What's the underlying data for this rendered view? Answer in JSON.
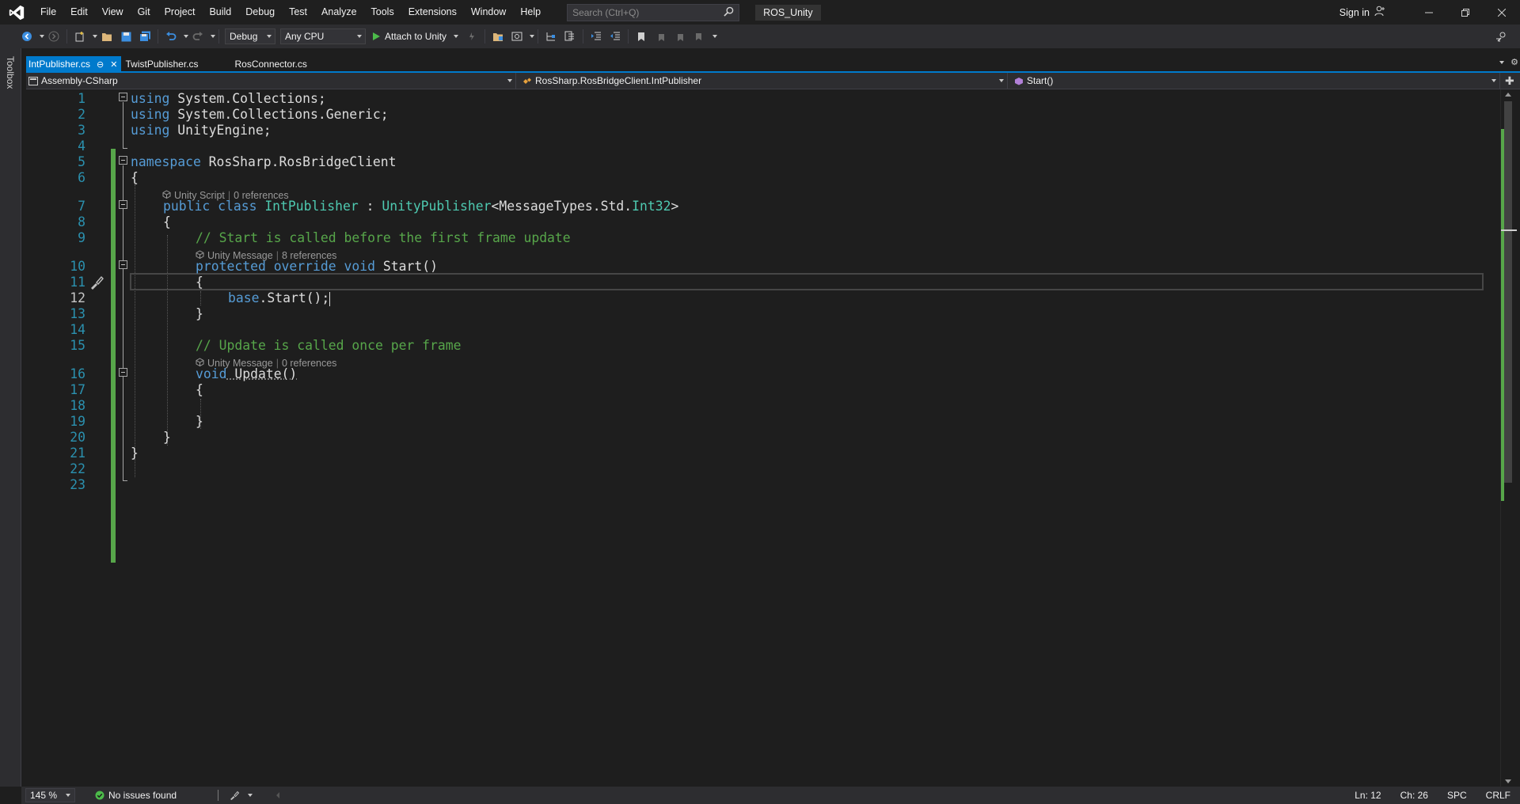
{
  "window": {
    "solution_name": "ROS_Unity",
    "sign_in": "Sign in"
  },
  "menu": {
    "items": [
      "File",
      "Edit",
      "View",
      "Git",
      "Project",
      "Build",
      "Debug",
      "Test",
      "Analyze",
      "Tools",
      "Extensions",
      "Window",
      "Help"
    ]
  },
  "search": {
    "placeholder": "Search (Ctrl+Q)"
  },
  "toolbar": {
    "configuration": "Debug",
    "platform": "Any CPU",
    "attach_label": "Attach to Unity"
  },
  "toolbox": {
    "label": "Toolbox"
  },
  "tabs": [
    {
      "label": "IntPublisher.cs",
      "active": true
    },
    {
      "label": "TwistPublisher.cs",
      "active": false
    },
    {
      "label": "RosConnector.cs",
      "active": false
    }
  ],
  "navbar": {
    "project": "Assembly-CSharp",
    "type": "RosSharp.RosBridgeClient.IntPublisher",
    "member": "Start()"
  },
  "code": {
    "line_numbers": [
      "1",
      "2",
      "3",
      "4",
      "5",
      "6",
      "7",
      "8",
      "9",
      "10",
      "11",
      "12",
      "13",
      "14",
      "15",
      "16",
      "17",
      "18",
      "19",
      "20",
      "21",
      "22",
      "23"
    ],
    "current_line": 12,
    "l1": {
      "kw": "using",
      "rest": " System.Collections;"
    },
    "l2": {
      "kw": "using",
      "rest": " System.Collections.Generic;"
    },
    "l3": {
      "kw": "using",
      "rest": " UnityEngine;"
    },
    "l5": {
      "kw": "namespace",
      "rest": " RosSharp.RosBridgeClient"
    },
    "l6": "{",
    "lens_class": {
      "kind": "Unity Script",
      "refs": "0 references"
    },
    "l7": {
      "kw1": "public",
      "kw2": "class",
      "name": "IntPublisher",
      "colon": " : ",
      "base": "UnityPublisher",
      "lt": "<",
      "ns": "MessageTypes.Std.",
      "arg": "Int32",
      "gt": ">"
    },
    "l8": "{",
    "l9": "// Start is called before the first frame update",
    "lens_start": {
      "kind": "Unity Message",
      "refs": "8 references"
    },
    "l10": {
      "kw1": "protected",
      "kw2": "override",
      "kw3": "void",
      "name": " Start()"
    },
    "l11": "{",
    "l12": {
      "kw": "base",
      "rest": ".Start();"
    },
    "l13": "}",
    "l15": "// Update is called once per frame",
    "lens_update": {
      "kind": "Unity Message",
      "refs": "0 references"
    },
    "l16": {
      "kw": "void",
      "name": " Update()"
    },
    "l17": "{",
    "l19": "}",
    "l20": "}",
    "l21": "}"
  },
  "status": {
    "zoom": "145 %",
    "issues": "No issues found",
    "line": "Ln: 12",
    "char": "Ch: 26",
    "whitespace": "SPC",
    "line_ending": "CRLF"
  },
  "colors": {
    "accent": "#007acc",
    "keyword": "#569cd6",
    "type": "#4ec9b0",
    "comment": "#57a64a",
    "line_number": "#2b91af"
  }
}
